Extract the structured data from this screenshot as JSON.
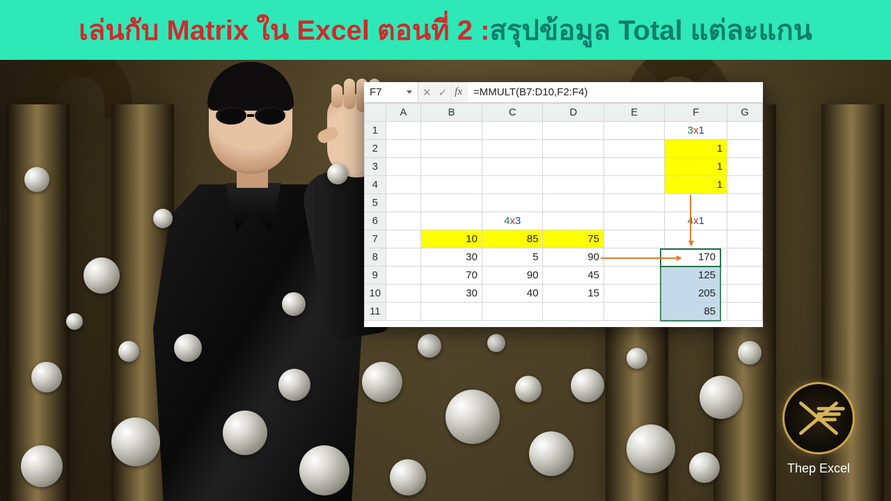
{
  "banner": {
    "part1": "เล่นกับ Matrix ใน Excel ตอนที่ 2 : ",
    "part2": "สรุปข้อมูล Total แต่ละแกน"
  },
  "excel": {
    "active_cell": "F7",
    "fx_label": "fx",
    "formula": "=MMULT(B7:D10,F2:F4)",
    "columns": [
      "A",
      "B",
      "C",
      "D",
      "E",
      "F",
      "G"
    ],
    "row_numbers": [
      "1",
      "2",
      "3",
      "4",
      "5",
      "6",
      "7",
      "8",
      "9",
      "10",
      "11"
    ],
    "dims": {
      "F1": {
        "a": "3",
        "x": "x",
        "b": "1"
      },
      "C6": {
        "a": "4",
        "x": "x",
        "b": "3"
      },
      "F6": {
        "a": "4",
        "x": "x",
        "b": "1"
      }
    },
    "vectorF": {
      "F2": "1",
      "F3": "1",
      "F4": "1"
    },
    "matrix": {
      "r7": {
        "B": "10",
        "C": "85",
        "D": "75"
      },
      "r8": {
        "B": "30",
        "C": "5",
        "D": "90"
      },
      "r9": {
        "B": "70",
        "C": "90",
        "D": "45"
      },
      "r10": {
        "B": "30",
        "C": "40",
        "D": "15"
      }
    },
    "result": {
      "F7": "170",
      "F8": "125",
      "F9": "205",
      "F10": "85"
    }
  },
  "brand": {
    "name": "Thep Excel"
  }
}
